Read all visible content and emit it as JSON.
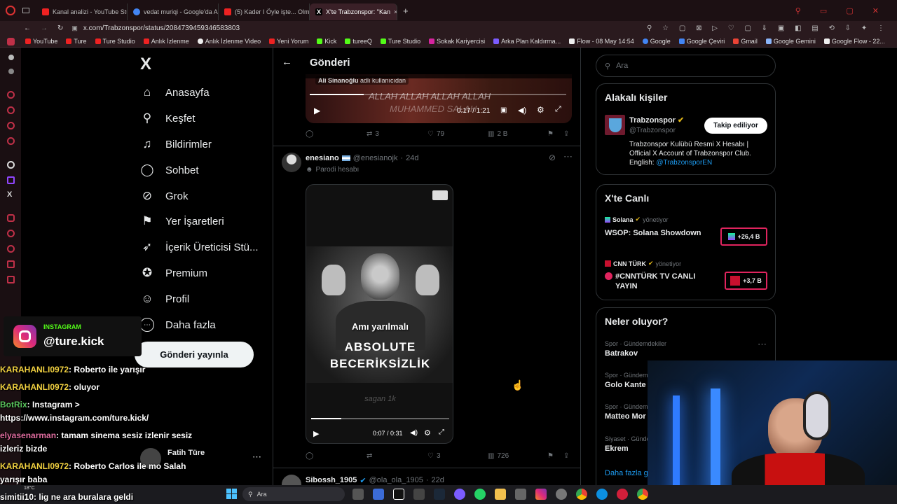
{
  "browser": {
    "tabs": [
      {
        "label": "Kanal analizi - YouTube Stu",
        "color": "#e22"
      },
      {
        "label": "vedat muriqi - Google'da A",
        "color": "#4285f4"
      },
      {
        "label": "(5) Kader I Öyle işte... Olm",
        "color": "#e22"
      },
      {
        "label": "X'te Trabzonspor: \"Kan",
        "color": "#fff"
      }
    ],
    "url": "x.com/Trabzonspor/status/2084739459346583803",
    "bookmarks": [
      "YouTube",
      "Ture",
      "Ture Studio",
      "Anlık İzlenme",
      "Anlık İzlenme Video",
      "Yeni Yorum",
      "Kick",
      "tureeQ",
      "Ture Studio",
      "Sokak Kariyercisi",
      "Arka Plan Kaldırma...",
      "Flow - 08 May 14:54",
      "Google",
      "Google Çeviri",
      "Gmail",
      "Google Gemini",
      "Google Flow - 22..."
    ]
  },
  "nav": {
    "logo": "X",
    "items": [
      {
        "label": "Anasayfa",
        "icon": "home-icon",
        "glyph": "⌂"
      },
      {
        "label": "Keşfet",
        "icon": "search-icon",
        "glyph": "⚲"
      },
      {
        "label": "Bildirimler",
        "icon": "bell-icon",
        "glyph": "♫"
      },
      {
        "label": "Sohbet",
        "icon": "chat-icon",
        "glyph": "◯"
      },
      {
        "label": "Grok",
        "icon": "grok-icon",
        "glyph": "⊘"
      },
      {
        "label": "Yer İşaretleri",
        "icon": "bookmark-icon",
        "glyph": "⚑"
      },
      {
        "label": "İçerik Üreticisi Stü...",
        "icon": "rocket-icon",
        "glyph": "➶"
      },
      {
        "label": "Premium",
        "icon": "verified-icon",
        "glyph": "✪"
      },
      {
        "label": "Profil",
        "icon": "person-icon",
        "glyph": "☺"
      },
      {
        "label": "Daha fazla",
        "icon": "more-icon",
        "glyph": "⋯"
      }
    ],
    "post_button": "Gönderi yayınla",
    "account_name": "Fatih Türe"
  },
  "header": {
    "title": "Gönderi",
    "back": "←"
  },
  "video1": {
    "watermark_user": "Ali Sinanoğlu",
    "watermark_suffix": "adlı kullanıcıdan",
    "caption_line1": "ALLAH ALLAH ALLAH ALLAH",
    "caption_line2": "MUHAMMED SALAH",
    "time": "0:17 / 1:21",
    "progress": 0.21
  },
  "post1_actions": {
    "reposts": "3",
    "likes": "79",
    "views": "2 B"
  },
  "post2": {
    "name": "enesiano",
    "handle": "@enesianojk",
    "time": "24d",
    "badge": "Parodi hesabı",
    "video_caption": "Amı yarılmalı",
    "video_title1": "ABSOLUTE",
    "video_title2": "BECERİKSİZLİK",
    "video_watermark": "sagan 1k",
    "time_display": "0:07 / 0:31",
    "progress": 0.22,
    "likes": "3",
    "views": "726"
  },
  "post3": {
    "name": "Sibossh_1905",
    "handle": "@ola_ola_1905",
    "time": "22d"
  },
  "search": {
    "placeholder": "Ara"
  },
  "related": {
    "title": "Alakalı kişiler",
    "name": "Trabzonspor",
    "handle": "@Trabzonspor",
    "follow_label": "Takip ediliyor",
    "bio": "Trabzonspor Kulübü Resmi X Hesabı | Official X Account of Trabzonspor Club. English:",
    "bio_link": "@TrabzonsporEN"
  },
  "live": {
    "title": "X'te Canlı",
    "items": [
      {
        "host": "Solana",
        "role": "yönetiyor",
        "title": "WSOP: Solana Showdown",
        "count": "+26,4 B"
      },
      {
        "host": "CNN TÜRK",
        "role": "yönetiyor",
        "title": "#CNNTÜRK TV CANLI YAYIN",
        "count": "+3,7 B"
      }
    ]
  },
  "trends": {
    "title": "Neler oluyor?",
    "items": [
      {
        "cat": "Spor · Gündemdekiler",
        "name": "Batrakov"
      },
      {
        "cat": "Spor · Gündem",
        "name": "Golo Kante"
      },
      {
        "cat": "Spor · Gündem",
        "name": "Matteo Mor"
      },
      {
        "cat": "Siyaset · Günde",
        "name": "Ekrem"
      }
    ],
    "more": "Daha fazla g"
  },
  "overlay": {
    "instagram_label": "INSTAGRAM",
    "instagram_handle": "@ture.kick",
    "chat": [
      {
        "user": "KARAHANLI0972",
        "msg": "Roberto ile yarışır"
      },
      {
        "user": "KARAHANLI0972",
        "msg": "oluyor"
      },
      {
        "user": "BotRix",
        "msg": "Instagram >"
      },
      {
        "user": "",
        "msg": "https://www.instagram.com/ture.kick/"
      },
      {
        "user": "elyasenarman",
        "msg": "tamam sinema sesiz izlenir sesiz"
      },
      {
        "user": "",
        "msg": "izleriz bizde"
      },
      {
        "user": "KARAHANLI0972",
        "msg": "Roberto Carlos ile mo Salah"
      },
      {
        "user": "",
        "msg": "yarışır baba"
      },
      {
        "user": "simitii10",
        "msg": "lig ne ara buralara geldi"
      }
    ]
  },
  "taskbar": {
    "search": "Ara",
    "weather": "18°C"
  }
}
